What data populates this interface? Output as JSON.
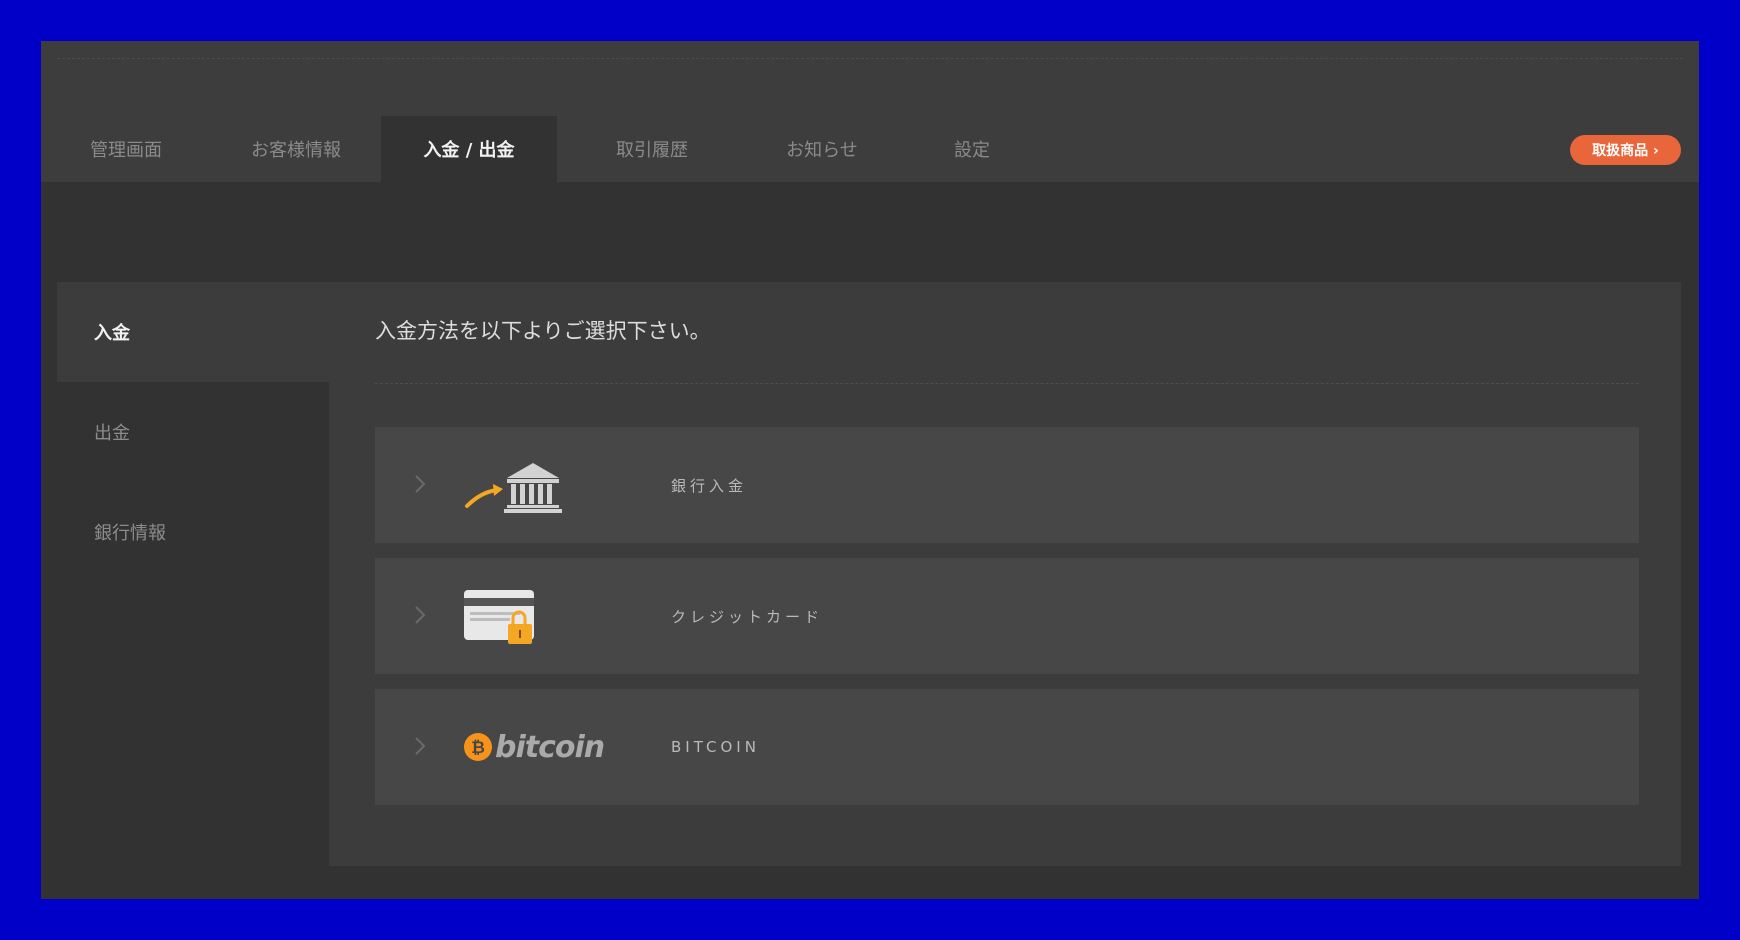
{
  "nav": {
    "tabs": [
      {
        "label": "管理画面"
      },
      {
        "label": "お客様情報"
      },
      {
        "label": "入金 / 出金"
      },
      {
        "label": "取引履歴"
      },
      {
        "label": "お知らせ"
      },
      {
        "label": "設定"
      }
    ],
    "active_tab": "入金 / 出金",
    "products_button": "取扱商品 ›"
  },
  "sidebar": {
    "items": [
      {
        "label": "入金"
      },
      {
        "label": "出金"
      },
      {
        "label": "銀行情報"
      }
    ],
    "active_item": "入金"
  },
  "main": {
    "instruction": "入金方法を以下よりご選択下さい。",
    "methods": [
      {
        "label": "銀行入金",
        "icon": "bank-deposit-icon"
      },
      {
        "label": "クレジットカード",
        "icon": "credit-card-lock-icon"
      },
      {
        "label": "BITCOIN",
        "icon": "bitcoin-logo",
        "logo_text": "bitcoin"
      }
    ]
  },
  "colors": {
    "frame_bg": "#0000c8",
    "nav_bg": "#3d3d3d",
    "content_bg": "#323232",
    "panel_bg": "#3c3c3c",
    "row_bg": "#474747",
    "accent": "#e9653a",
    "bitcoin_orange": "#f7931a"
  }
}
